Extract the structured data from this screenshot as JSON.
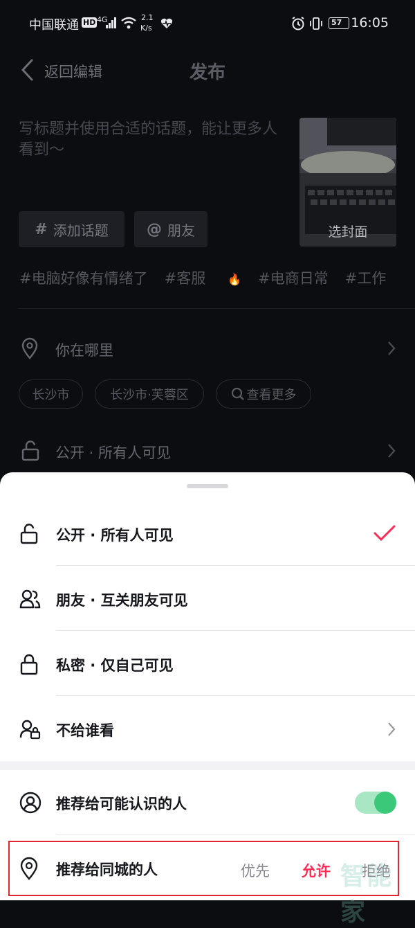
{
  "status_bar": {
    "carrier": "中国联通",
    "hd": "HD",
    "network": "4G",
    "speed": "2.1",
    "speed_unit": "K/s",
    "battery": "57",
    "time": "16:05"
  },
  "header": {
    "back_label": "返回编辑",
    "title": "发布"
  },
  "post": {
    "title_placeholder": "写标题并使用合适的话题，能让更多人看到～",
    "cover_label": "选封面",
    "add_topic": "添加话题",
    "mention": "朋友",
    "topics": [
      "#电脑好像有情绪了",
      "#客服",
      "#电商日常",
      "#工作"
    ]
  },
  "location": {
    "label": "你在哪里",
    "suggestions": [
      "长沙市",
      "长沙市·芙蓉区"
    ],
    "more": "查看更多"
  },
  "privacy_row": {
    "label": "公开 · 所有人可见"
  },
  "sheet": {
    "options": [
      {
        "icon": "unlock-icon",
        "label": "公开 · 所有人可见",
        "selected": true
      },
      {
        "icon": "friends-icon",
        "label": "朋友 · 互关朋友可见",
        "selected": false
      },
      {
        "icon": "lock-icon",
        "label": "私密 · 仅自己可见",
        "selected": false
      },
      {
        "icon": "user-lock-icon",
        "label": "不给谁看",
        "selected": false
      }
    ],
    "recommend_known": {
      "label": "推荐给可能认识的人",
      "enabled": true
    },
    "recommend_city": {
      "label": "推荐给同城的人",
      "choices": [
        "优先",
        "允许",
        "拒绝"
      ],
      "selected": "允许"
    }
  },
  "watermark": "智能家",
  "colors": {
    "accent": "#fe2c55",
    "toggle_on": "#3bc878",
    "highlight_box": "#e0262e"
  }
}
